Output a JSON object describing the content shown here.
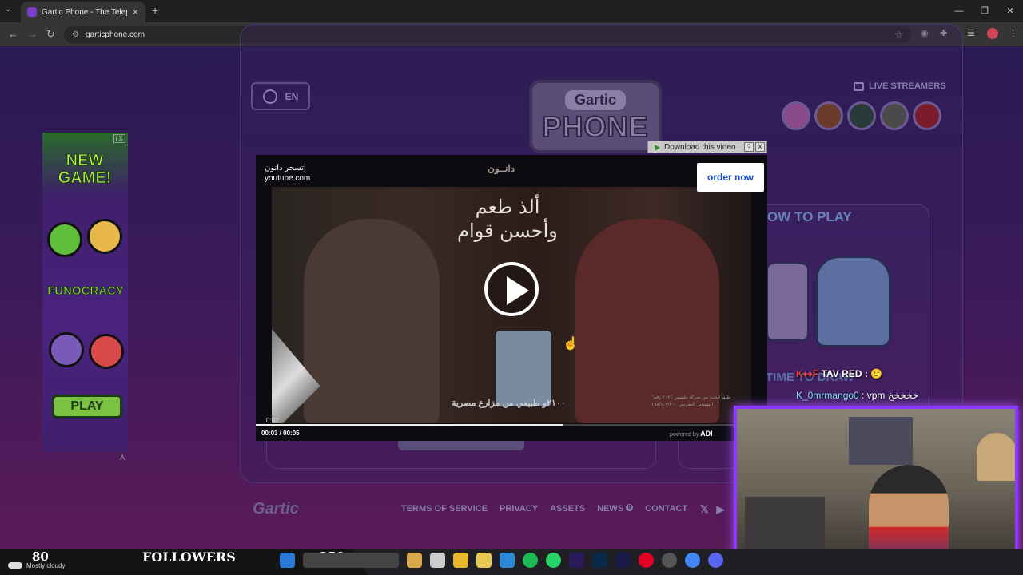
{
  "browser": {
    "tab_title": "Gartic Phone - The Telepho",
    "url": "garticphone.com",
    "new_tab": "+",
    "tab_close": "✕"
  },
  "page": {
    "language": "EN",
    "logo_top": "Gartic",
    "logo_main": "PHONE",
    "live_streamers_label": "LIVE STREAMERS",
    "how_to_play": "OW TO PLAY",
    "time_to_draw": "TIME TO DRAW",
    "footer_logo": "Gartic",
    "footer_links": [
      "TERMS OF SERVICE",
      "PRIVACY",
      "ASSETS",
      "NEWS",
      "CONTACT"
    ],
    "news_badge": "8",
    "social": [
      "𝕏",
      "▶"
    ]
  },
  "left_ad": {
    "close": "i X",
    "headline": "NEW GAME!",
    "brand": "FUNOCRACY",
    "cta": "PLAY",
    "label": "A"
  },
  "video_ad": {
    "advertiser": "إتسحر دانون",
    "source": "youtube.com",
    "brand_ar": "دانــون",
    "title_ar": "ألذ طعم وأحسن قوام",
    "cta": "order now",
    "tagline_ar": "٢١٠٠و طبيعي من مزارع مصرية",
    "fine_print_ar": "*طبقاً لبحث من شركة نيلسين ٢٠٢٤ رقم التسجيل الضريبي ١٦٨/١٠٢/٢٠٠",
    "elapsed_marker": "0:02",
    "time": "00:03 / 00:05",
    "progress": 0.6,
    "powered_by": "powered by",
    "vendor": "ADI",
    "download_label": "Download this video",
    "help": "?",
    "close": "X"
  },
  "stream_overlay": {
    "chat": [
      {
        "user": "K♦♦F",
        "text": "TAV RED : 🙂"
      },
      {
        "user": "K_0mrmango0",
        "text": ": vpm خخخخخ"
      }
    ],
    "stats_left": "80",
    "weather": "Mostly cloudy",
    "followers_label": "FOLLOWERS",
    "stats_right": "250"
  }
}
